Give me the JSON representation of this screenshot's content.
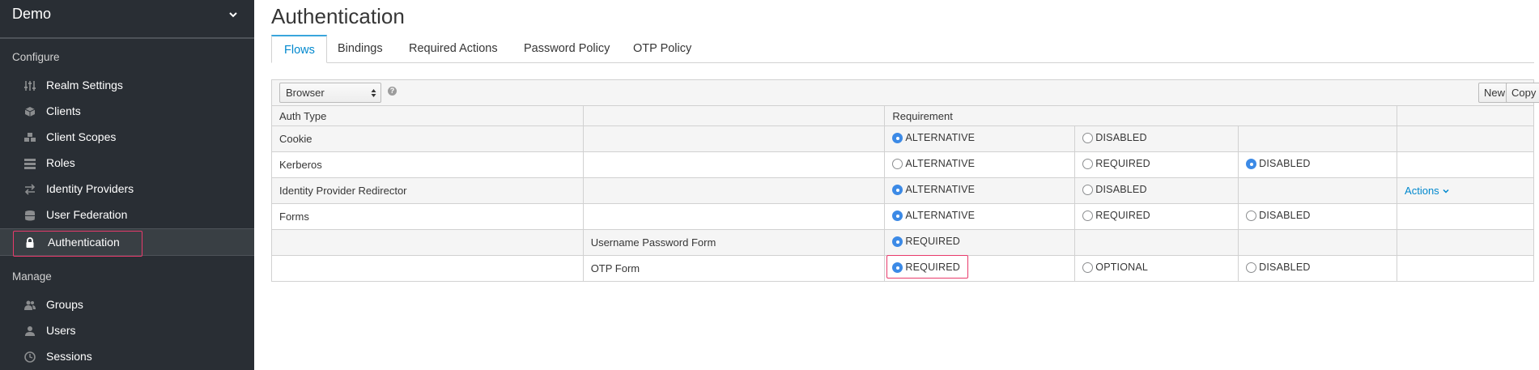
{
  "sidebar": {
    "realm": "Demo",
    "configure_title": "Configure",
    "manage_title": "Manage",
    "configure_items": [
      {
        "label": "Realm Settings",
        "icon": "sliders-icon"
      },
      {
        "label": "Clients",
        "icon": "cube-icon"
      },
      {
        "label": "Client Scopes",
        "icon": "cubes-icon"
      },
      {
        "label": "Roles",
        "icon": "list-icon"
      },
      {
        "label": "Identity Providers",
        "icon": "exchange-icon"
      },
      {
        "label": "User Federation",
        "icon": "database-icon"
      },
      {
        "label": "Authentication",
        "icon": "lock-icon"
      }
    ],
    "manage_items": [
      {
        "label": "Groups",
        "icon": "users-icon"
      },
      {
        "label": "Users",
        "icon": "user-icon"
      },
      {
        "label": "Sessions",
        "icon": "clock-icon"
      }
    ]
  },
  "header": {
    "title": "Authentication"
  },
  "tabs": [
    "Flows",
    "Bindings",
    "Required Actions",
    "Password Policy",
    "OTP Policy"
  ],
  "toolbar": {
    "flow": "Browser",
    "help": "?",
    "new_label": "New",
    "copy_label": "Copy"
  },
  "table": {
    "headers": {
      "auth_type": "Auth Type",
      "requirement": "Requirement"
    },
    "rows": [
      {
        "name": "Cookie",
        "sub": "",
        "opts": [
          [
            "ALTERNATIVE",
            true
          ],
          [
            "DISABLED",
            false
          ]
        ],
        "action": ""
      },
      {
        "name": "Kerberos",
        "sub": "",
        "opts": [
          [
            "ALTERNATIVE",
            false
          ],
          [
            "REQUIRED",
            false
          ],
          [
            "DISABLED",
            true
          ]
        ],
        "action": ""
      },
      {
        "name": "Identity Provider Redirector",
        "sub": "",
        "opts": [
          [
            "ALTERNATIVE",
            true
          ],
          [
            "DISABLED",
            false
          ]
        ],
        "action": "Actions"
      },
      {
        "name": "Forms",
        "sub": "",
        "opts": [
          [
            "ALTERNATIVE",
            true
          ],
          [
            "REQUIRED",
            false
          ],
          [
            "DISABLED",
            false
          ]
        ],
        "action": ""
      },
      {
        "name": "",
        "sub": "Username Password Form",
        "opts": [
          [
            "REQUIRED",
            true
          ]
        ],
        "action": ""
      },
      {
        "name": "",
        "sub": "OTP Form",
        "opts": [
          [
            "REQUIRED",
            true
          ],
          [
            "OPTIONAL",
            false
          ],
          [
            "DISABLED",
            false
          ]
        ],
        "action": ""
      }
    ]
  },
  "colors": {
    "sidebar_bg": "#292e34",
    "accent": "#0088ce",
    "radio_checked": "#3c8ae6",
    "highlight": "#e83a6b"
  }
}
